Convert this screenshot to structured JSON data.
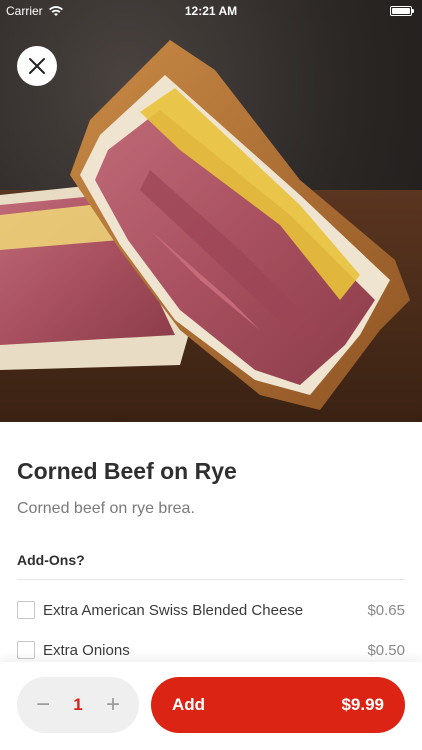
{
  "status_bar": {
    "carrier": "Carrier",
    "time": "12:21 AM"
  },
  "hero": {
    "image_alt": "Corned beef on rye sandwich photo"
  },
  "item": {
    "title": "Corned Beef on Rye",
    "description": "Corned beef on rye brea."
  },
  "addons": {
    "header": "Add-Ons?",
    "items": [
      {
        "label": "Extra American Swiss Blended Cheese",
        "price": "$0.65",
        "checked": false
      },
      {
        "label": "Extra Onions",
        "price": "$0.50",
        "checked": false
      }
    ]
  },
  "cart": {
    "quantity": "1",
    "decrement": "−",
    "increment": "+",
    "add_label": "Add",
    "total": "$9.99"
  },
  "colors": {
    "accent": "#dc2415",
    "quantity_text": "#d6231a"
  },
  "icons": [
    "wifi-icon",
    "battery-icon",
    "close-icon",
    "minus-icon",
    "plus-icon"
  ]
}
